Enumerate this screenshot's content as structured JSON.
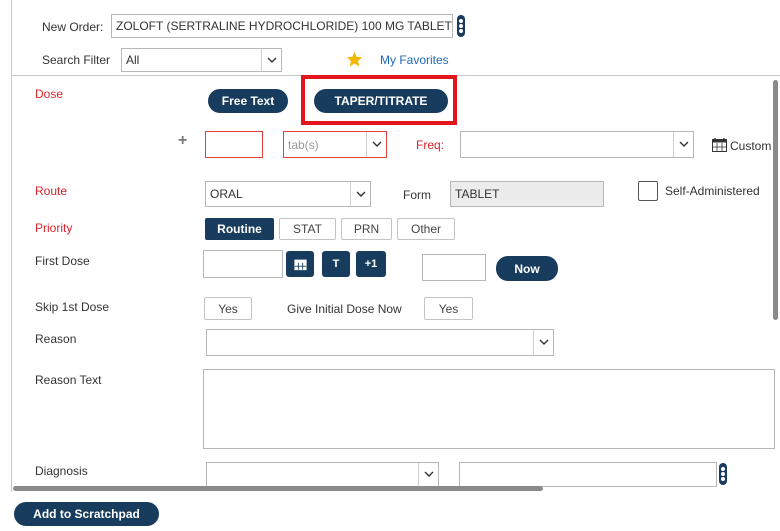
{
  "header": {
    "new_order_label": "New Order:",
    "new_order_value": "ZOLOFT (SERTRALINE HYDROCHLORIDE) 100 MG TABLET",
    "search_filter_label": "Search Filter",
    "search_filter_value": "All",
    "favorites_label": "My Favorites"
  },
  "dose": {
    "label": "Dose",
    "free_text_button": "Free Text",
    "taper_button": "TAPER/TITRATE",
    "plus": "+",
    "amount_value": "",
    "unit_value": "tab(s)",
    "freq_label": "Freq:",
    "freq_value": "",
    "custom_label": "Custom"
  },
  "route": {
    "label": "Route",
    "value": "ORAL",
    "form_label": "Form",
    "form_value": "TABLET",
    "self_admin_label": "Self-Administered"
  },
  "priority": {
    "label": "Priority",
    "options": [
      "Routine",
      "STAT",
      "PRN",
      "Other"
    ],
    "selected": "Routine"
  },
  "first_dose": {
    "label": "First Dose",
    "date_value": "",
    "t_button": "T",
    "plus_one_button": "+1",
    "time_value": "",
    "now_button": "Now"
  },
  "skip_first": {
    "label": "Skip 1st Dose",
    "yes": "Yes",
    "give_initial_label": "Give Initial Dose Now",
    "give_initial_yes": "Yes"
  },
  "reason": {
    "label": "Reason",
    "value": ""
  },
  "reason_text": {
    "label": "Reason Text",
    "value": ""
  },
  "diagnosis": {
    "label": "Diagnosis",
    "value": "",
    "text_value": ""
  },
  "footer": {
    "add_scratchpad": "Add to Scratchpad"
  },
  "colors": {
    "accent_navy": "#183c5d",
    "required_red": "#d9252a",
    "highlight_red": "#e3141b",
    "favorites_star": "#f5b800",
    "link_blue": "#1f66b8"
  },
  "icons": [
    "kebab-menu-icon",
    "chevron-down-icon",
    "star-icon",
    "calendar-icon",
    "plus-icon"
  ]
}
